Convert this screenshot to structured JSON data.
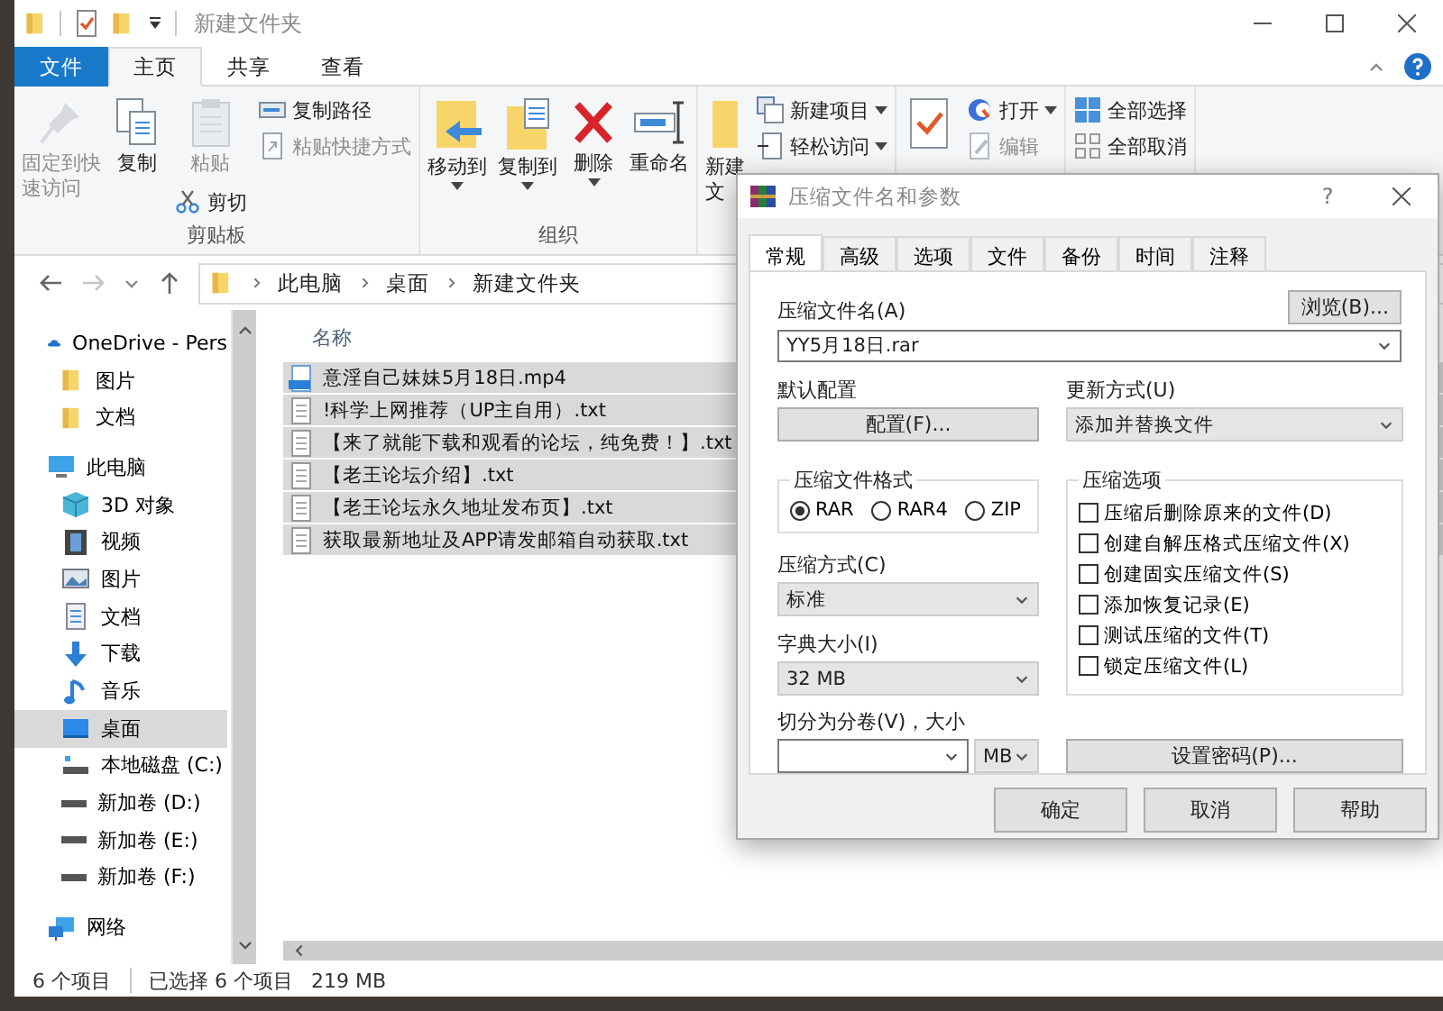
{
  "window": {
    "title": "新建文件夹"
  },
  "ribbon": {
    "tabs": [
      {
        "label": "文件",
        "kind": "file",
        "selected": false
      },
      {
        "label": "主页",
        "kind": "tab",
        "selected": true
      },
      {
        "label": "共享",
        "kind": "tab",
        "selected": false
      },
      {
        "label": "查看",
        "kind": "tab",
        "selected": false
      }
    ],
    "groups": [
      {
        "label": "剪贴板",
        "columns": [
          [
            {
              "label": [
                "固定到快",
                "速访问"
              ],
              "kind": "large",
              "disabled": true,
              "dropdown": false
            }
          ],
          [
            {
              "label": "复制",
              "kind": "large",
              "disabled": false,
              "dropdown": false
            }
          ],
          [
            {
              "label": "粘贴",
              "kind": "large",
              "disabled": true,
              "dropdown": false
            },
            {
              "label": "剪切",
              "kind": "small",
              "disabled": false,
              "dropdown": false
            }
          ],
          [
            {
              "label": "复制路径",
              "kind": "small",
              "disabled": false,
              "dropdown": false
            },
            {
              "label": "粘贴快捷方式",
              "kind": "small",
              "disabled": true,
              "dropdown": false
            }
          ]
        ]
      },
      {
        "label": "组织",
        "columns": [
          [
            {
              "label": "移动到",
              "kind": "large",
              "disabled": false,
              "dropdown": true
            }
          ],
          [
            {
              "label": "复制到",
              "kind": "large",
              "disabled": false,
              "dropdown": true
            }
          ],
          [
            {
              "label": "删除",
              "kind": "large",
              "disabled": false,
              "dropdown": true
            }
          ],
          [
            {
              "label": "重命名",
              "kind": "large",
              "disabled": false,
              "dropdown": false
            }
          ]
        ]
      },
      {
        "columns": [
          [
            {
              "label": [
                "新建",
                "文"
              ],
              "kind": "large",
              "disabled": false,
              "dropdown": false
            }
          ],
          [
            {
              "label": "新建项目",
              "kind": "small",
              "disabled": false,
              "dropdown": true
            },
            {
              "label": "轻松访问",
              "kind": "small",
              "disabled": false,
              "dropdown": true
            }
          ]
        ]
      },
      {
        "columns": [
          [
            {
              "kind": "large",
              "disabled": false,
              "dropdown": false
            }
          ],
          [
            {
              "label": "打开",
              "kind": "small",
              "disabled": false,
              "dropdown": true
            },
            {
              "label": "编辑",
              "kind": "small",
              "disabled": true,
              "dropdown": false
            }
          ]
        ]
      },
      {
        "columns": [
          [
            {
              "label": "全部选择",
              "kind": "small",
              "disabled": false,
              "dropdown": false
            },
            {
              "label": "全部取消",
              "kind": "small",
              "disabled": false,
              "dropdown": false
            }
          ]
        ]
      }
    ]
  },
  "address": [
    "此电脑",
    "桌面",
    "新建文件夹"
  ],
  "navigation": [
    {
      "label": "OneDrive - Pers",
      "selected": false,
      "children": [
        {
          "label": "图片",
          "selected": false
        },
        {
          "label": "文档",
          "selected": false
        }
      ]
    },
    {
      "label": "此电脑",
      "selected": false,
      "children": [
        {
          "label": "3D 对象",
          "selected": false
        },
        {
          "label": "视频",
          "selected": false
        },
        {
          "label": "图片",
          "selected": false
        },
        {
          "label": "文档",
          "selected": false
        },
        {
          "label": "下载",
          "selected": false
        },
        {
          "label": "音乐",
          "selected": false
        },
        {
          "label": "桌面",
          "selected": true
        },
        {
          "label": "本地磁盘 (C:)",
          "selected": false
        },
        {
          "label": "新加卷 (D:)",
          "selected": false
        },
        {
          "label": "新加卷 (E:)",
          "selected": false
        },
        {
          "label": "新加卷 (F:)",
          "selected": false
        }
      ]
    },
    {
      "label": "网络",
      "selected": false
    }
  ],
  "files": {
    "columns": [
      "名称"
    ],
    "rows": [
      {
        "name": "意淫自己妹妹5月18日.mp4",
        "kind": "video",
        "selected": true
      },
      {
        "name": "!科学上网推荐（UP主自用）.txt",
        "kind": "text",
        "selected": true
      },
      {
        "name": "【来了就能下载和观看的论坛，纯免费！】.txt",
        "kind": "text",
        "selected": true
      },
      {
        "name": "【老王论坛介绍】.txt",
        "kind": "text",
        "selected": true
      },
      {
        "name": "【老王论坛永久地址发布页】.txt",
        "kind": "text",
        "selected": true
      },
      {
        "name": "获取最新地址及APP请发邮箱自动获取.txt",
        "kind": "text",
        "selected": true
      }
    ]
  },
  "status_bar": {
    "count": "6 个项目",
    "selection": "已选择 6 个项目",
    "size": "219 MB"
  },
  "dialog": {
    "title": "压缩文件名和参数",
    "help": "?",
    "tabs": [
      {
        "label": "常规",
        "selected": true
      },
      {
        "label": "高级",
        "selected": false
      },
      {
        "label": "选项",
        "selected": false
      },
      {
        "label": "文件",
        "selected": false
      },
      {
        "label": "备份",
        "selected": false
      },
      {
        "label": "时间",
        "selected": false
      },
      {
        "label": "注释",
        "selected": false
      }
    ],
    "archive_name": {
      "label": "压缩文件名(A)",
      "value": "YY5月18日.rar"
    },
    "browse_button": "浏览(B)...",
    "profiles": {
      "label": "默认配置",
      "button": "配置(F)..."
    },
    "update_mode": {
      "label": "更新方式(U)",
      "value": "添加并替换文件"
    },
    "format": {
      "label": "压缩文件格式",
      "options": [
        {
          "label": "RAR",
          "selected": true
        },
        {
          "label": "RAR4",
          "selected": false
        },
        {
          "label": "ZIP",
          "selected": false
        }
      ]
    },
    "method": {
      "label": "压缩方式(C)",
      "value": "标准"
    },
    "dictionary": {
      "label": "字典大小(I)",
      "value": "32 MB"
    },
    "split": {
      "label": "切分为分卷(V)，大小",
      "unit": "MB"
    },
    "options": {
      "label": "压缩选项",
      "items": [
        {
          "label": "压缩后删除原来的文件(D)",
          "checked": false
        },
        {
          "label": "创建自解压格式压缩文件(X)",
          "checked": false
        },
        {
          "label": "创建固实压缩文件(S)",
          "checked": false
        },
        {
          "label": "添加恢复记录(E)",
          "checked": false
        },
        {
          "label": "测试压缩的文件(T)",
          "checked": false
        },
        {
          "label": "锁定压缩文件(L)",
          "checked": false
        }
      ]
    },
    "password_button": "设置密码(P)...",
    "buttons": [
      "确定",
      "取消",
      "帮助"
    ]
  }
}
